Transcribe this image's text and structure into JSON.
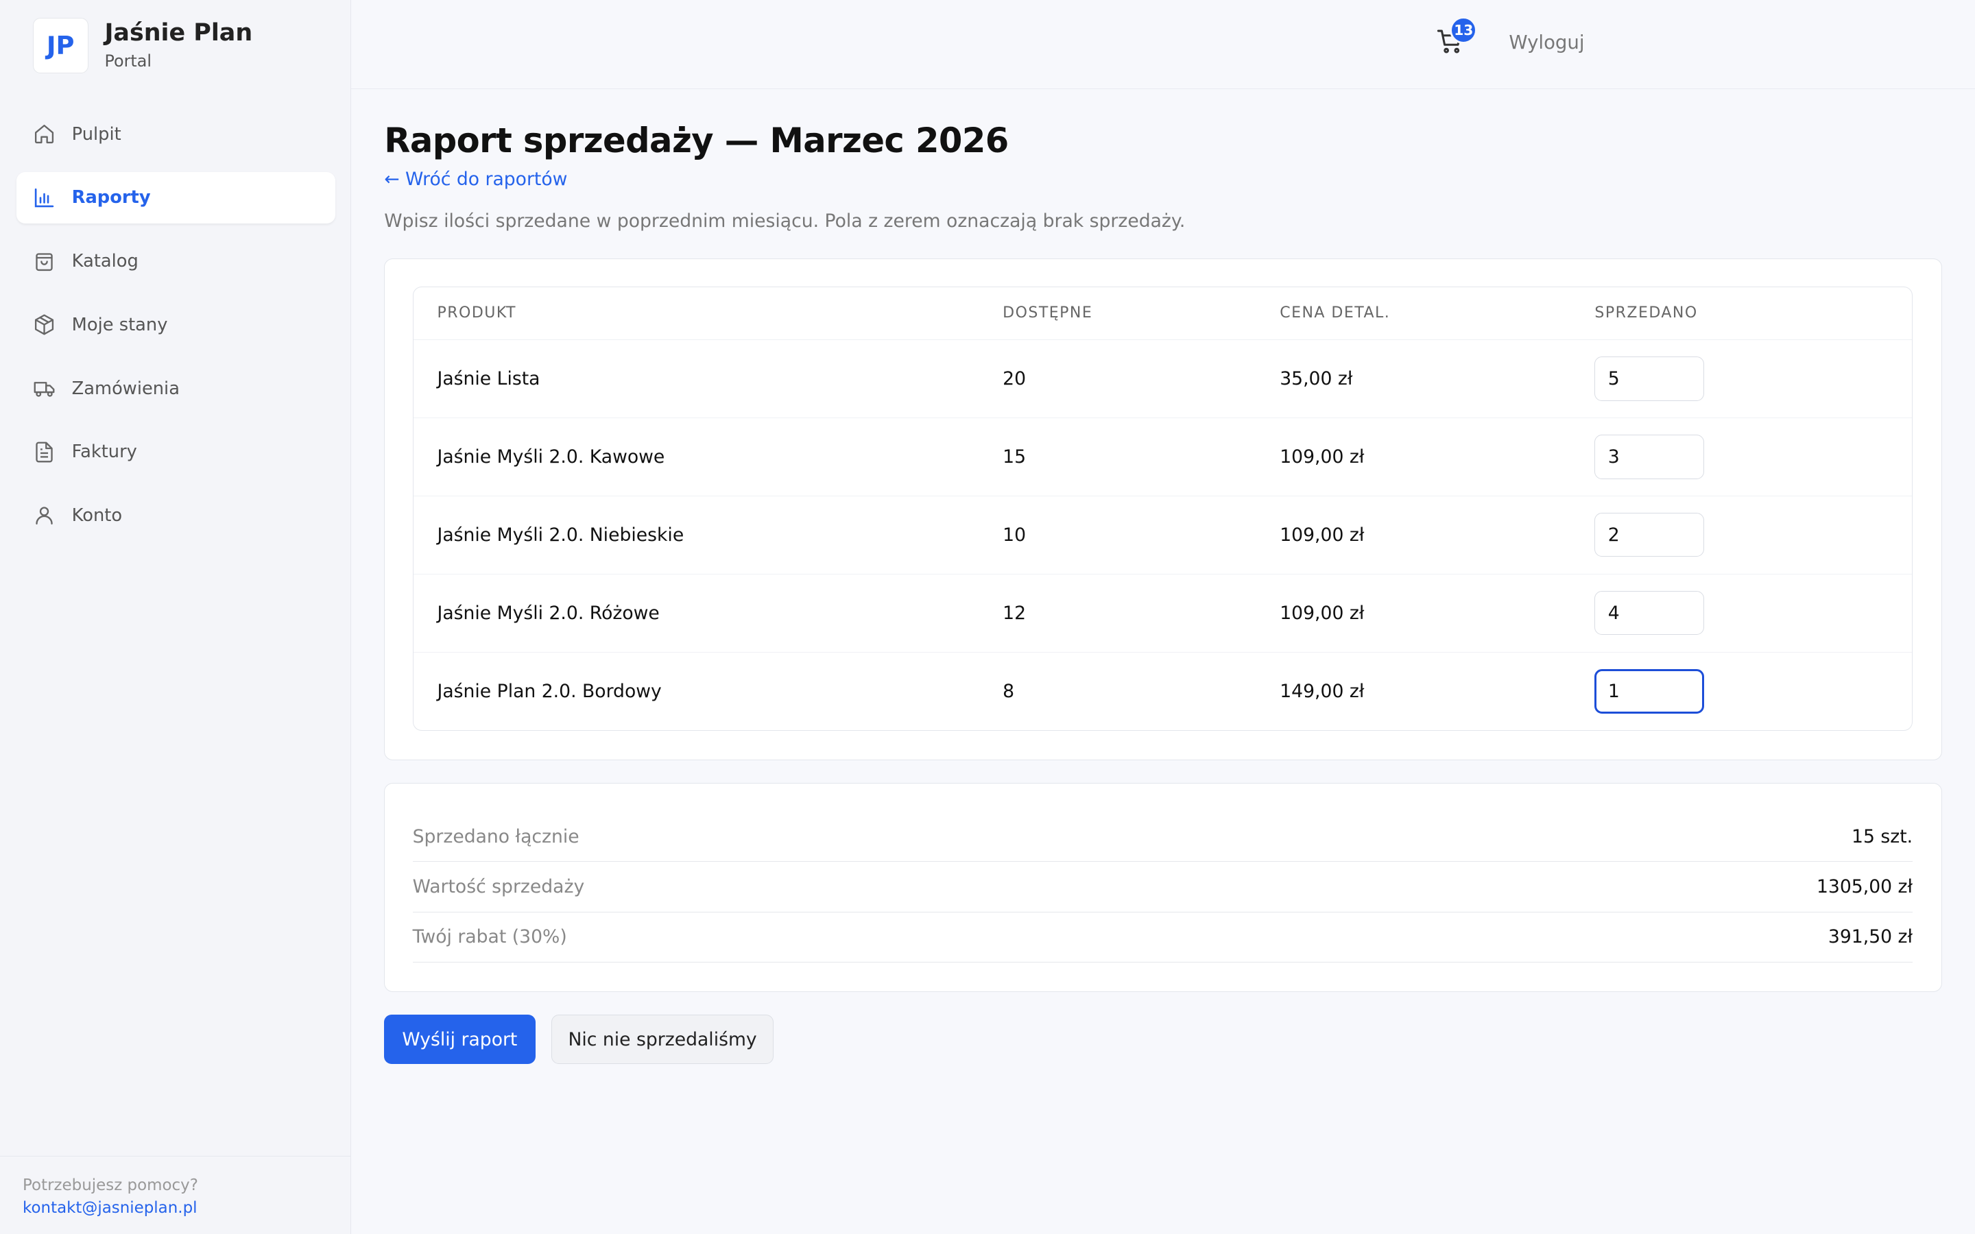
{
  "brand": {
    "logo": "JP",
    "name": "Jaśnie Plan",
    "subtitle": "Portal"
  },
  "nav": [
    {
      "label": "Pulpit",
      "icon": "home-icon"
    },
    {
      "label": "Raporty",
      "icon": "chart-icon",
      "active": true
    },
    {
      "label": "Katalog",
      "icon": "bag-icon"
    },
    {
      "label": "Moje stany",
      "icon": "box-icon"
    },
    {
      "label": "Zamówienia",
      "icon": "truck-icon"
    },
    {
      "label": "Faktury",
      "icon": "document-icon"
    },
    {
      "label": "Konto",
      "icon": "user-icon"
    }
  ],
  "help": {
    "question": "Potrzebujesz pomocy?",
    "email": "kontakt@jasnieplan.pl"
  },
  "topbar": {
    "cart_count": "13",
    "logout": "Wyloguj"
  },
  "page": {
    "title": "Raport sprzedaży — Marzec 2026",
    "back_link": "← Wróć do raportów",
    "description": "Wpisz ilości sprzedane w poprzednim miesiącu. Pola z zerem oznaczają brak sprzedaży."
  },
  "table": {
    "headers": [
      "PRODUKT",
      "DOSTĘPNE",
      "CENA DETAL.",
      "SPRZEDANO"
    ],
    "rows": [
      {
        "product": "Jaśnie Lista",
        "available": "20",
        "price": "35,00 zł",
        "sold": "5"
      },
      {
        "product": "Jaśnie Myśli 2.0. Kawowe",
        "available": "15",
        "price": "109,00 zł",
        "sold": "3"
      },
      {
        "product": "Jaśnie Myśli 2.0. Niebieskie",
        "available": "10",
        "price": "109,00 zł",
        "sold": "2"
      },
      {
        "product": "Jaśnie Myśli 2.0. Różowe",
        "available": "12",
        "price": "109,00 zł",
        "sold": "4"
      },
      {
        "product": "Jaśnie Plan 2.0. Bordowy",
        "available": "8",
        "price": "149,00 zł",
        "sold": "1"
      }
    ]
  },
  "summary": {
    "total_label": "Sprzedano łącznie",
    "total_value": "15 szt.",
    "value_label": "Wartość sprzedaży",
    "value_value": "1305,00 zł",
    "discount_label": "Twój rabat (30%)",
    "discount_value": "391,50 zł"
  },
  "actions": {
    "submit": "Wyślij raport",
    "nothing_sold": "Nic nie sprzedaliśmy"
  },
  "colors": {
    "accent": "#2563eb",
    "background": "#f7f8fc"
  }
}
